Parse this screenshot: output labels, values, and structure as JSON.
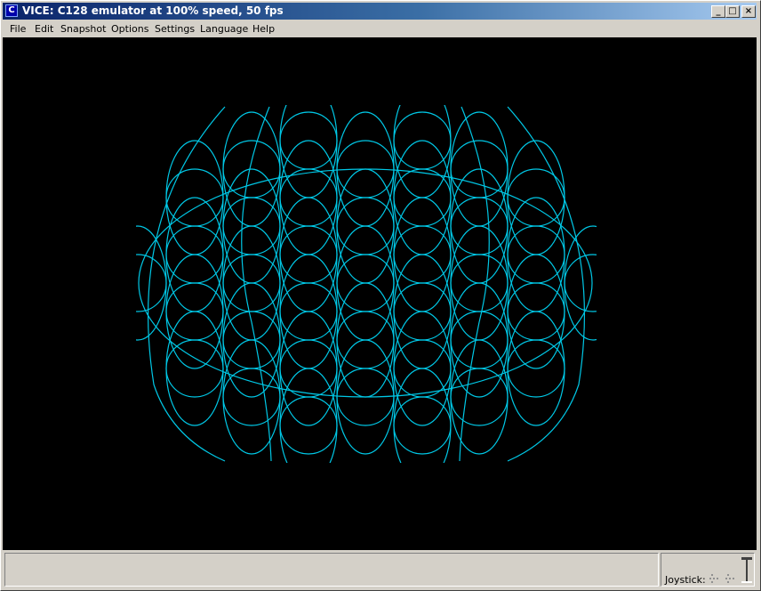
{
  "window": {
    "title": "VICE: C128 emulator at 100% speed, 50 fps"
  },
  "title_buttons": {
    "minimize": "_",
    "maximize": "□",
    "close": "×"
  },
  "menu": [
    {
      "label": "File"
    },
    {
      "label": "Edit"
    },
    {
      "label": "Snapshot"
    },
    {
      "label": "Options"
    },
    {
      "label": "Settings"
    },
    {
      "label": "Language"
    },
    {
      "label": "Help"
    }
  ],
  "screen": {
    "background": "#000000",
    "pattern_color": "#00c8e6",
    "image": "overlapping-circles-pattern"
  },
  "status": {
    "message": "",
    "joystick_label": "Joystick:"
  },
  "icons": {
    "app": "vice-app-icon",
    "joystick": "joystick-icon"
  }
}
